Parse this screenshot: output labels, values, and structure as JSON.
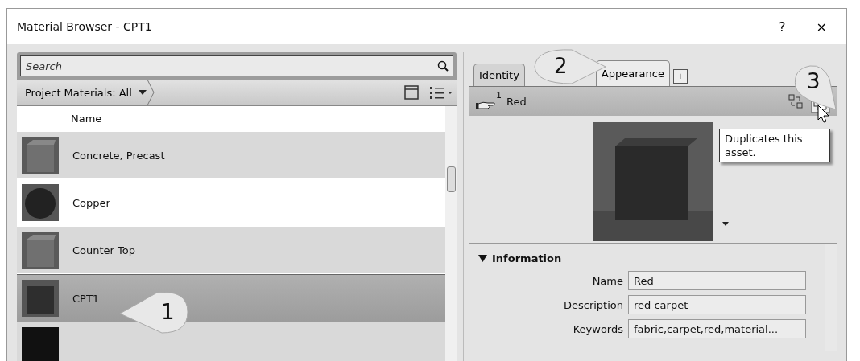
{
  "window": {
    "title": "Material Browser - CPT1",
    "help": "?",
    "close": "×"
  },
  "search": {
    "placeholder": "Search"
  },
  "library_bar": {
    "label": "Project Materials: All"
  },
  "table": {
    "columns": [
      "Name"
    ],
    "rows": [
      {
        "name": "Concrete, Precast",
        "kind": "cube",
        "selected": false
      },
      {
        "name": "Copper",
        "kind": "sphere",
        "selected": false
      },
      {
        "name": "Counter Top",
        "kind": "cube",
        "selected": false
      },
      {
        "name": "CPT1",
        "kind": "carpet",
        "selected": true
      },
      {
        "kind": "dark",
        "selected": false
      }
    ]
  },
  "tabs": [
    {
      "label": "Identity",
      "selected": false
    },
    {
      "label": "Appearance",
      "selected": true
    }
  ],
  "add_tab": "+",
  "asset": {
    "count": "1",
    "name": "Red"
  },
  "tooltip": "Duplicates this asset.",
  "section": {
    "title": "Information",
    "expanded": true,
    "fields": [
      {
        "label": "Name",
        "value": "Red"
      },
      {
        "label": "Description",
        "value": "red carpet"
      },
      {
        "label": "Keywords",
        "value": "fabric,carpet,red,material..."
      }
    ]
  },
  "callouts": [
    "1",
    "2",
    "3"
  ]
}
